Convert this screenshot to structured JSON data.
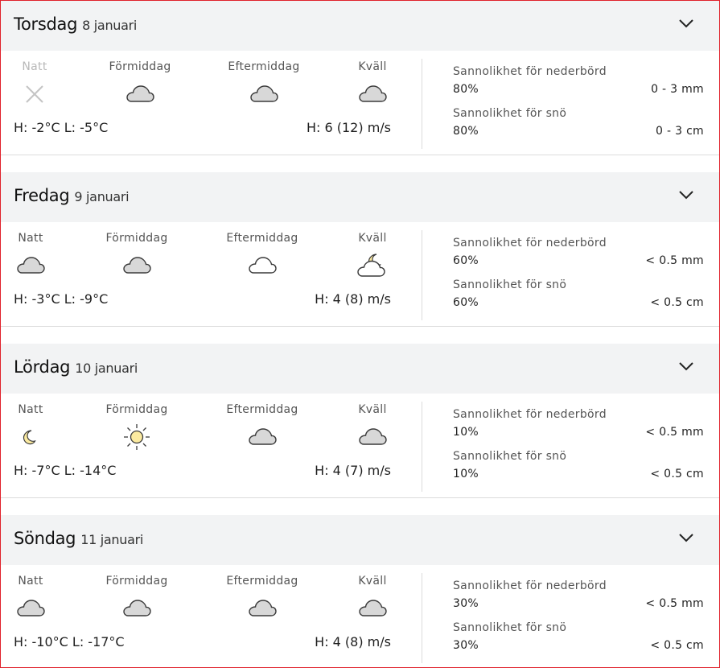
{
  "labels": {
    "periods": [
      "Natt",
      "Förmiddag",
      "Eftermiddag",
      "Kväll"
    ],
    "precip_prob": "Sannolikhet för nederbörd",
    "snow_prob": "Sannolikhet för snö"
  },
  "colors": {
    "header_bg": "#f2f3f4",
    "border_accent": "#e0212b",
    "cloud_fill": "#d8d8d8",
    "sun_fill": "#fbeaa0"
  },
  "days": [
    {
      "dow": "Torsdag",
      "date": "8 januari",
      "icons": [
        "unavailable-x",
        "cloud",
        "cloud",
        "cloud"
      ],
      "temps": "H: -2°C L: -5°C",
      "wind": "H: 6 (12) m/s",
      "precip_pct": "80%",
      "precip_amt": "0 - 3 mm",
      "snow_pct": "80%",
      "snow_amt": "0 - 3 cm"
    },
    {
      "dow": "Fredag",
      "date": "9 januari",
      "icons": [
        "cloud",
        "cloud",
        "cloud-outline",
        "cloud-moon"
      ],
      "temps": "H: -3°C L: -9°C",
      "wind": "H: 4 (8) m/s",
      "precip_pct": "60%",
      "precip_amt": "< 0.5 mm",
      "snow_pct": "60%",
      "snow_amt": "< 0.5 cm"
    },
    {
      "dow": "Lördag",
      "date": "10 januari",
      "icons": [
        "moon",
        "sun",
        "cloud",
        "cloud"
      ],
      "temps": "H: -7°C L: -14°C",
      "wind": "H: 4 (7) m/s",
      "precip_pct": "10%",
      "precip_amt": "< 0.5 mm",
      "snow_pct": "10%",
      "snow_amt": "< 0.5 cm"
    },
    {
      "dow": "Söndag",
      "date": "11 januari",
      "icons": [
        "cloud",
        "cloud",
        "cloud",
        "cloud"
      ],
      "temps": "H: -10°C L: -17°C",
      "wind": "H: 4 (8) m/s",
      "precip_pct": "30%",
      "precip_amt": "< 0.5 mm",
      "snow_pct": "30%",
      "snow_amt": "< 0.5 cm"
    }
  ]
}
